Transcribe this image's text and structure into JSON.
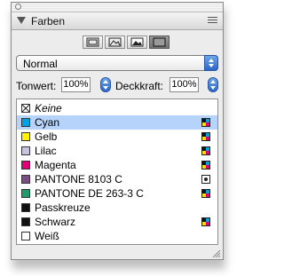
{
  "panel": {
    "title": "Farben"
  },
  "toolbar": {
    "buttons": [
      {
        "icon": "frame-icon",
        "active": false
      },
      {
        "icon": "image-outline-icon",
        "active": false
      },
      {
        "icon": "image-filled-icon",
        "active": false
      },
      {
        "icon": "solid-frame-icon",
        "active": true
      }
    ]
  },
  "mode_select": {
    "value": "Normal"
  },
  "tint": {
    "label": "Tonwert:",
    "value": "100%"
  },
  "opacity": {
    "label": "Deckkraft:",
    "value": "100%"
  },
  "colors": [
    {
      "name": "Keine",
      "swatch": "none",
      "type": "",
      "italic": true,
      "selected": false
    },
    {
      "name": "Cyan",
      "swatch": "#00a0e6",
      "type": "process",
      "italic": false,
      "selected": true
    },
    {
      "name": "Gelb",
      "swatch": "#fff200",
      "type": "process",
      "italic": false,
      "selected": false
    },
    {
      "name": "Lilac",
      "swatch": "#c9c3e0",
      "type": "process",
      "italic": false,
      "selected": false
    },
    {
      "name": "Magenta",
      "swatch": "#e2007a",
      "type": "process",
      "italic": false,
      "selected": false
    },
    {
      "name": "PANTONE 8103 C",
      "swatch": "#7a4d86",
      "type": "spot",
      "italic": false,
      "selected": false
    },
    {
      "name": "PANTONE DE 263-3 C",
      "swatch": "#1f9a6b",
      "type": "process",
      "italic": false,
      "selected": false
    },
    {
      "name": "Passkreuze",
      "swatch": "#111111",
      "type": "",
      "italic": false,
      "selected": false
    },
    {
      "name": "Schwarz",
      "swatch": "#111111",
      "type": "process",
      "italic": false,
      "selected": false
    },
    {
      "name": "Weiß",
      "swatch": "#ffffff",
      "type": "",
      "italic": false,
      "selected": false
    }
  ],
  "accent_color": "#2c67c9",
  "selection_color": "#b5d3fb"
}
